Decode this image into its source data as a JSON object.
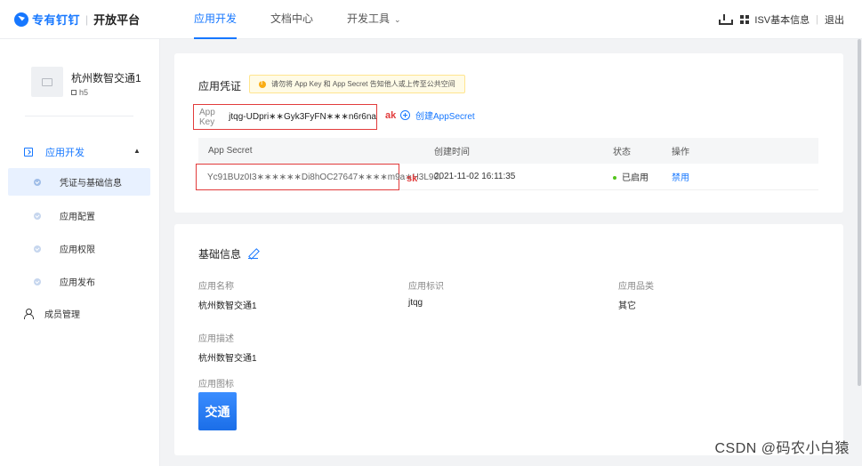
{
  "logo": {
    "brand": "专有钉钉",
    "product": "开放平台"
  },
  "nav": [
    {
      "label": "应用开发",
      "active": true
    },
    {
      "label": "文档中心",
      "active": false
    },
    {
      "label": "开发工具",
      "active": false,
      "has_caret": true
    }
  ],
  "top_right": {
    "isv_label": "ISV基本信息",
    "logout": "退出"
  },
  "sidebar": {
    "app_name": "杭州数智交通1",
    "app_tag": "h5",
    "group_label": "应用开发",
    "items": [
      {
        "label": "凭证与基础信息",
        "active": true
      },
      {
        "label": "应用配置",
        "active": false
      },
      {
        "label": "应用权限",
        "active": false
      },
      {
        "label": "应用发布",
        "active": false
      }
    ],
    "member_label": "成员管理"
  },
  "credentials": {
    "title": "应用凭证",
    "notice": "请勿将 App Key 和 App Secret 告知他人或上传至公共空间",
    "app_key_label": "App Key",
    "app_key_value": "jtqg-UDpri∗∗Gyk3FyFN∗∗∗n6r6na",
    "ak_tag": "ak",
    "create_secret": "创建AppSecret",
    "table_headers": [
      "App Secret",
      "创建时间",
      "状态",
      "操作"
    ],
    "rows": [
      {
        "secret": "Yc91BUz0I3∗∗∗∗∗∗Di8hOC27647∗∗∗∗m9a∗H3L90I",
        "created": "2021-11-02 16:11:35",
        "status": "已启用",
        "action": "禁用"
      }
    ],
    "sk_tag": "sk"
  },
  "basic": {
    "title": "基础信息",
    "fields": [
      {
        "label": "应用名称",
        "value": "杭州数智交通1"
      },
      {
        "label": "应用标识",
        "value": "jtqg"
      },
      {
        "label": "应用品类",
        "value": "其它"
      }
    ],
    "desc_label": "应用描述",
    "desc_value": "杭州数智交通1",
    "icon_label": "应用图标",
    "icon_text": "交通"
  },
  "watermark": "CSDN @码农小白猿",
  "colors": {
    "accent": "#1677ff",
    "highlight_border": "#e23b3b",
    "status_green": "#52c41a"
  }
}
